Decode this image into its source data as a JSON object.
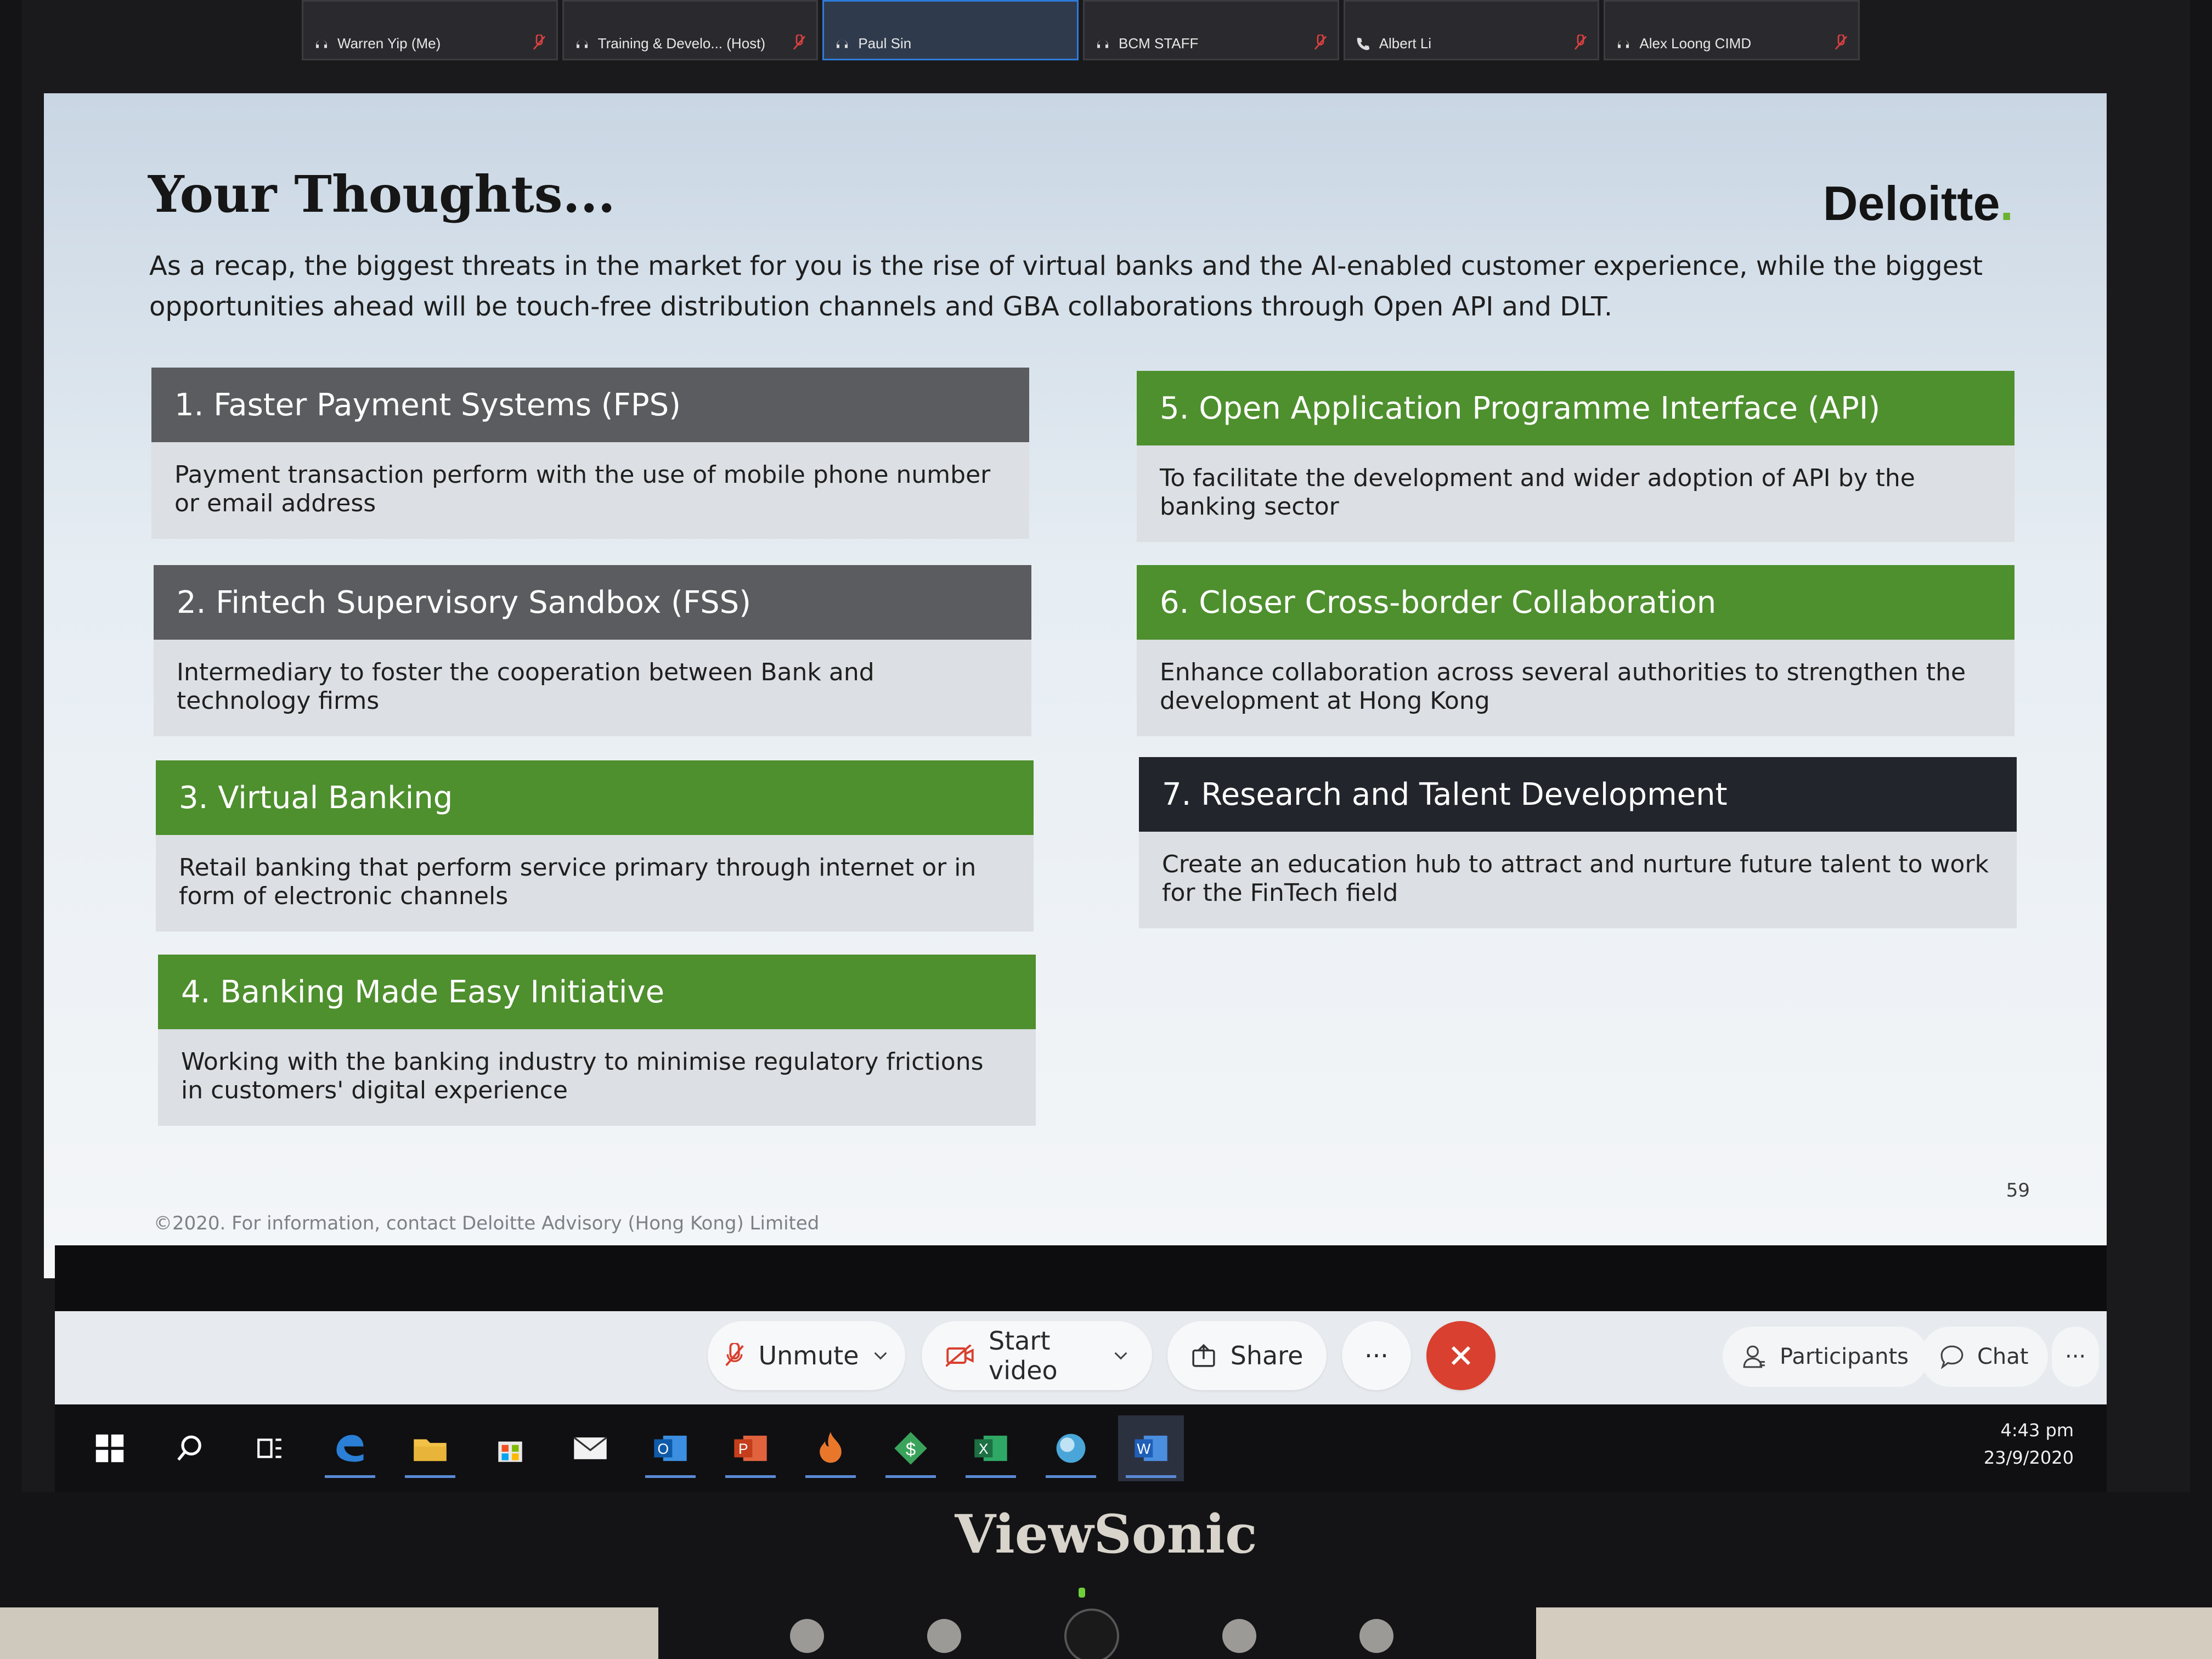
{
  "participants": [
    {
      "name": "Warren Yip (Me)",
      "active": false
    },
    {
      "name": "Training & Develo... (Host)",
      "active": false
    },
    {
      "name": "Paul Sin",
      "active": true
    },
    {
      "name": "BCM STAFF",
      "active": false
    },
    {
      "name": "Albert Li",
      "active": false
    },
    {
      "name": "Alex Loong CIMD",
      "active": false
    }
  ],
  "slide": {
    "title": "Your Thoughts...",
    "logo_text": "Deloitte",
    "logo_dot": ".",
    "intro": "As a recap, the biggest threats in the market for you is the rise of virtual banks and the AI-enabled customer experience, while the biggest opportunities ahead will be touch-free distribution channels and GBA collaborations through Open API and DLT.",
    "cards": [
      {
        "title": "1. Faster Payment Systems (FPS)",
        "body": "Payment transaction perform with the use of mobile phone number or email address",
        "color": "#5b5c60"
      },
      {
        "title": "2. Fintech Supervisory Sandbox (FSS)",
        "body": "Intermediary to foster the cooperation between Bank and technology firms",
        "color": "#5b5c60"
      },
      {
        "title": "3. Virtual Banking",
        "body": "Retail banking that perform service primary through internet or in form of electronic channels",
        "color": "#4e8f2e"
      },
      {
        "title": "4. Banking Made Easy Initiative",
        "body": "Working with the banking industry to minimise regulatory frictions in customers' digital experience",
        "color": "#4e8f2e"
      },
      {
        "title": "5. Open Application Programme Interface (API)",
        "body": "To facilitate the development and wider adoption of API by the banking sector",
        "color": "#4e8f2e"
      },
      {
        "title": "6. Closer Cross-border Collaboration",
        "body": "Enhance collaboration across several authorities to strengthen the development at Hong Kong",
        "color": "#4e8f2e"
      },
      {
        "title": "7. Research and Talent Development",
        "body": "Create an education hub to attract and nurture future talent to work for the FinTech field",
        "color": "#22252b"
      }
    ],
    "footer": "©2020. For information, contact Deloitte Advisory (Hong Kong) Limited",
    "page_number": "59"
  },
  "toolbar": {
    "unmute_label": "Unmute",
    "start_video_label": "Start video",
    "share_label": "Share",
    "more_label": "···",
    "participants_label": "Participants",
    "chat_label": "Chat",
    "overflow_label": "···"
  },
  "taskbar": {
    "apps": [
      "windows-start",
      "search",
      "task-view",
      "edge",
      "file-explorer",
      "store",
      "mail",
      "outlook",
      "powerpoint",
      "app-flame",
      "app-dollar",
      "excel",
      "app-globe",
      "word"
    ],
    "time": "4:43 pm",
    "date": "23/9/2020"
  },
  "bezel": {
    "brand": "ViewSonic"
  }
}
